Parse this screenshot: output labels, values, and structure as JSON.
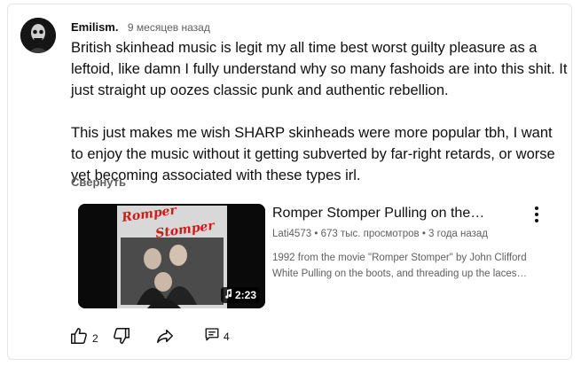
{
  "comment": {
    "author": "Emilism.",
    "timestamp": "9 месяцев назад",
    "paragraphs": [
      "British skinhead music is legit my all time best worst guilty pleasure as a leftoid, like damn I fully understand why so many fashoids are into this shit. It just straight up oozes classic punk and authentic rebellion.",
      "This just makes me wish SHARP skinheads were more popular tbh, I want to enjoy the music without it getting subverted by far-right retards, or worse yet becoming associated with these types irl."
    ],
    "collapse_label": "Свернуть"
  },
  "video": {
    "title": "Romper Stomper Pulling on the…",
    "channel": "Lati4573",
    "views": "673 тыс. просмотров",
    "age": "3 года назад",
    "separator": "•",
    "description_lines": [
      "1992 from the movie \"Romper Stomper\" by John Clifford",
      "White Pulling on the boots, and threading up the laces…"
    ],
    "duration": "2:23",
    "thumbnail_text": [
      "Romper",
      "Stomper"
    ],
    "menu_icon": "more-vert-icon"
  },
  "actions": {
    "like_count": "2",
    "reply_count": "4",
    "icons": [
      "thumbs-up-icon",
      "thumbs-down-icon",
      "share-icon",
      "comment-icon"
    ]
  },
  "colors": {
    "text_primary": "#0f0f0f",
    "text_secondary": "#606060",
    "card_border": "#e5e5e5",
    "poster_red": "#d01a1a"
  }
}
